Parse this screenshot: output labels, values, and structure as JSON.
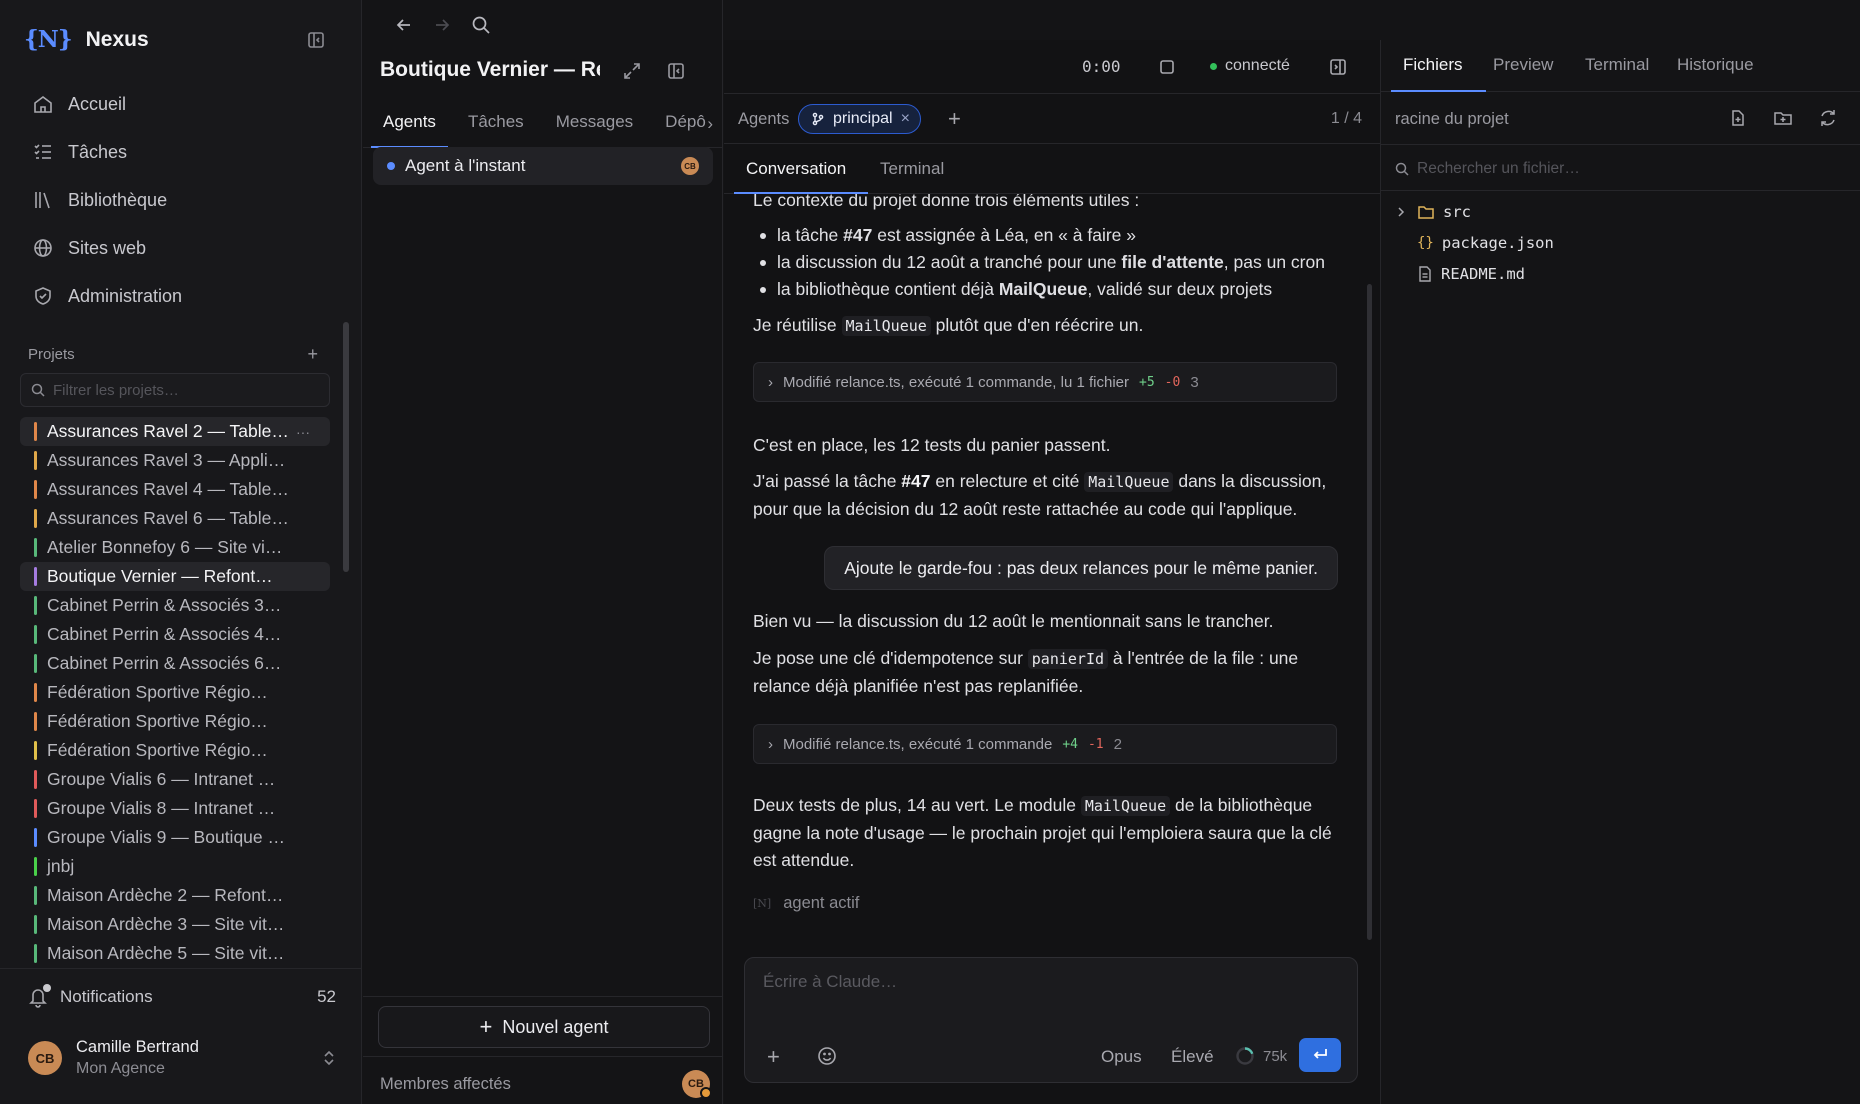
{
  "app": {
    "logo": "{N}",
    "name": "Nexus"
  },
  "nav": [
    {
      "label": "Accueil",
      "icon": "home-icon"
    },
    {
      "label": "Tâches",
      "icon": "tasks-icon"
    },
    {
      "label": "Bibliothèque",
      "icon": "library-icon"
    },
    {
      "label": "Sites web",
      "icon": "globe-icon"
    },
    {
      "label": "Administration",
      "icon": "shield-icon"
    }
  ],
  "projects": {
    "heading": "Projets",
    "filter_placeholder": "Filtrer les projets…",
    "items": [
      {
        "label": "Assurances Ravel 2 — Table…",
        "color": "#e0874a",
        "more": "···"
      },
      {
        "label": "Assurances Ravel 3 — Appli…",
        "color": "#e0a84a"
      },
      {
        "label": "Assurances Ravel 4 — Table…",
        "color": "#e0874a"
      },
      {
        "label": "Assurances Ravel 6 — Table…",
        "color": "#e0a84a"
      },
      {
        "label": "Atelier Bonnefoy 6 — Site vi…",
        "color": "#58b87a"
      },
      {
        "label": "Boutique Vernier — Refont…",
        "color": "#a57ce0"
      },
      {
        "label": "Cabinet Perrin & Associés 3…",
        "color": "#58b87a"
      },
      {
        "label": "Cabinet Perrin & Associés 4…",
        "color": "#58b87a"
      },
      {
        "label": "Cabinet Perrin & Associés 6…",
        "color": "#58b87a"
      },
      {
        "label": "Fédération Sportive Régio…",
        "color": "#e0874a"
      },
      {
        "label": "Fédération Sportive Régio…",
        "color": "#e0874a"
      },
      {
        "label": "Fédération Sportive Régio…",
        "color": "#e0c04a"
      },
      {
        "label": "Groupe Vialis 6 — Intranet …",
        "color": "#e05a5a"
      },
      {
        "label": "Groupe Vialis 8 — Intranet …",
        "color": "#e05a5a"
      },
      {
        "label": "Groupe Vialis 9 — Boutique …",
        "color": "#5b8cff"
      },
      {
        "label": "jnbj",
        "color": "#4ad04a"
      },
      {
        "label": "Maison Ardèche 2 — Refont…",
        "color": "#58b87a"
      },
      {
        "label": "Maison Ardèche 3 — Site vit…",
        "color": "#58b87a"
      },
      {
        "label": "Maison Ardèche 5 — Site vit…",
        "color": "#58b87a"
      }
    ]
  },
  "notifications": {
    "label": "Notifications",
    "count": "52"
  },
  "user": {
    "initials": "CB",
    "name": "Camille Bertrand",
    "org": "Mon Agence"
  },
  "project_panel": {
    "title": "Boutique Vernier — Re…",
    "tabs": [
      "Agents",
      "Tâches",
      "Messages",
      "Dépô"
    ],
    "agent_row": {
      "label": "Agent à l'instant",
      "badge": "CB"
    },
    "new_agent_label": "Nouvel agent",
    "members_label": "Membres affectés",
    "members_badge": "CB"
  },
  "chat": {
    "timer": "0:00",
    "status": "connecté",
    "agents_label": "Agents",
    "branch": "principal",
    "agent_count": "1 / 4",
    "tabs": [
      "Conversation",
      "Terminal"
    ],
    "msg1_intro": "Le contexte du projet donne trois éléments utiles :",
    "bullet1": {
      "pre": "la tâche ",
      "bold": "#47",
      "post": " est assignée à Léa, en « à faire »"
    },
    "bullet2": {
      "pre": "la discussion du 12 août a tranché pour une ",
      "bold": "file d'attente",
      "post": ", pas un cron"
    },
    "bullet3": {
      "pre": "la bibliothèque contient déjà ",
      "bold": "MailQueue",
      "post": ", validé sur deux projets"
    },
    "msg1_reuse": {
      "pre": "Je réutilise ",
      "code": "MailQueue",
      "post": " plutôt que d'en réécrire un."
    },
    "tool1": {
      "label": "Modifié relance.ts, exécuté 1 commande, lu 1 fichier",
      "plus": "+5",
      "minus": "-0",
      "n": "3"
    },
    "msg2_a": "C'est en place, les 12 tests du panier passent.",
    "msg2_b": {
      "pre": "J'ai passé la tâche ",
      "bold": "#47",
      "mid": " en relecture et cité ",
      "code": "MailQueue",
      "post": " dans la discussion, pour que la décision du 12 août reste rattachée au code qui l'applique."
    },
    "user_msg": "Ajoute le garde-fou : pas deux relances pour le même panier.",
    "msg3_a": "Bien vu — la discussion du 12 août le mentionnait sans le trancher.",
    "msg3_b": {
      "pre": "Je pose une clé d'idempotence sur ",
      "code": "panierId",
      "post": " à l'entrée de la file : une relance déjà planifiée n'est pas replanifiée."
    },
    "tool2": {
      "label": "Modifié relance.ts, exécuté 1 commande",
      "plus": "+4",
      "minus": "-1",
      "n": "2"
    },
    "msg4": {
      "pre": "Deux tests de plus, 14 au vert. Le module ",
      "code": "MailQueue",
      "post": " de la bibliothèque gagne la note d'usage — le prochain projet qui l'emploiera saura que la clé est attendue."
    },
    "agent_status_mini": "[N]",
    "agent_status": "agent actif",
    "composer_placeholder": "Écrire à Claude…",
    "model": "Opus",
    "effort": "Élevé",
    "context": "75k"
  },
  "files_panel": {
    "tabs": [
      "Fichiers",
      "Preview",
      "Terminal",
      "Historique"
    ],
    "path": "racine du projet",
    "search_placeholder": "Rechercher un fichier…",
    "tree": [
      {
        "name": "src",
        "type": "folder"
      },
      {
        "name": "package.json",
        "type": "json"
      },
      {
        "name": "README.md",
        "type": "file"
      }
    ]
  },
  "colors": {
    "accent": "#5b8cff",
    "connected": "#33c05a",
    "send": "#2f6fe0"
  }
}
